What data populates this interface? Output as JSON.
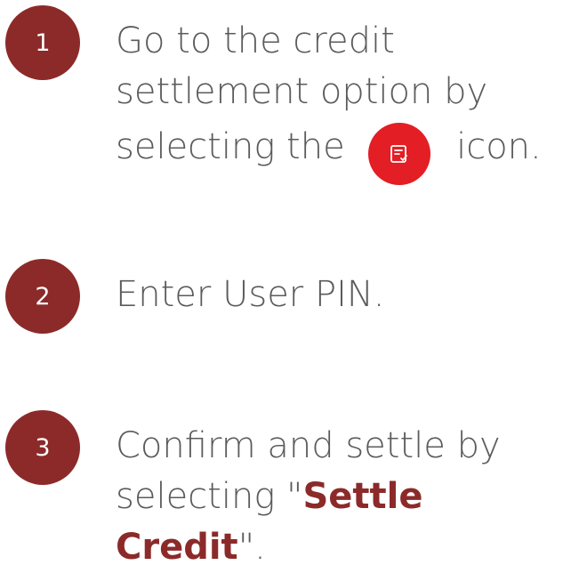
{
  "steps": [
    {
      "number": "1",
      "text_before_icon": "Go to the credit settlement option by selecting the",
      "text_after_icon": "icon.",
      "icon": "document-check-icon"
    },
    {
      "number": "2",
      "text": "Enter User PIN."
    },
    {
      "number": "3",
      "text_before": "Confirm and settle by selecting \"",
      "highlight": "Settle Credit",
      "text_after": "\"."
    }
  ],
  "colors": {
    "badge": "#8c2a2a",
    "icon_circle": "#e31e24",
    "text": "#5b5b5b",
    "highlight": "#8c2a2a"
  }
}
